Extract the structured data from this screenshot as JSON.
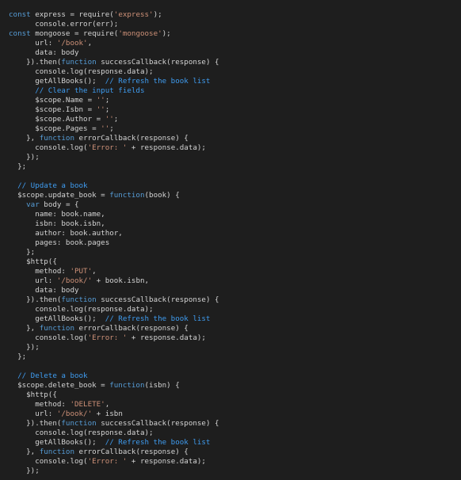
{
  "colors": {
    "background": "#1e1e1e",
    "keyword": "#569cd6",
    "string": "#ce9178",
    "comment": "#3f9cf0",
    "text": "#d4d4d4"
  },
  "lines": [
    [
      [
        "kw",
        "const"
      ],
      [
        "p",
        " express = require("
      ],
      [
        "s",
        "'express'"
      ],
      [
        "p",
        ");"
      ]
    ],
    [
      [
        "p",
        "      console.error(err);"
      ]
    ],
    [
      [
        "kw",
        "const"
      ],
      [
        "p",
        " mongoose = require("
      ],
      [
        "s",
        "'mongoose'"
      ],
      [
        "p",
        ");"
      ]
    ],
    [
      [
        "p",
        "      url: "
      ],
      [
        "s",
        "'/book'"
      ],
      [
        "p",
        ","
      ]
    ],
    [
      [
        "p",
        "      data: body"
      ]
    ],
    [
      [
        "p",
        "    }).then("
      ],
      [
        "kw",
        "function"
      ],
      [
        "p",
        " successCallback(response) {"
      ]
    ],
    [
      [
        "p",
        "      console.log(response.data);"
      ]
    ],
    [
      [
        "p",
        "      getAllBooks();  "
      ],
      [
        "c",
        "// Refresh the book list"
      ]
    ],
    [
      [
        "p",
        "      "
      ],
      [
        "c",
        "// Clear the input fields"
      ]
    ],
    [
      [
        "p",
        "      $scope.Name = "
      ],
      [
        "s",
        "''"
      ],
      [
        "p",
        ";"
      ]
    ],
    [
      [
        "p",
        "      $scope.Isbn = "
      ],
      [
        "s",
        "''"
      ],
      [
        "p",
        ";"
      ]
    ],
    [
      [
        "p",
        "      $scope.Author = "
      ],
      [
        "s",
        "''"
      ],
      [
        "p",
        ";"
      ]
    ],
    [
      [
        "p",
        "      $scope.Pages = "
      ],
      [
        "s",
        "''"
      ],
      [
        "p",
        ";"
      ]
    ],
    [
      [
        "p",
        "    }, "
      ],
      [
        "kw",
        "function"
      ],
      [
        "p",
        " errorCallback(response) {"
      ]
    ],
    [
      [
        "p",
        "      console.log("
      ],
      [
        "s",
        "'Error: '"
      ],
      [
        "p",
        " + response.data);"
      ]
    ],
    [
      [
        "p",
        "    });"
      ]
    ],
    [
      [
        "p",
        "  };"
      ]
    ],
    [
      [
        "p",
        ""
      ]
    ],
    [
      [
        "p",
        "  "
      ],
      [
        "c",
        "// Update a book"
      ]
    ],
    [
      [
        "p",
        "  $scope.update_book = "
      ],
      [
        "kw",
        "function"
      ],
      [
        "p",
        "(book) {"
      ]
    ],
    [
      [
        "p",
        "    "
      ],
      [
        "kw",
        "var"
      ],
      [
        "p",
        " body = {"
      ]
    ],
    [
      [
        "p",
        "      name: book.name,"
      ]
    ],
    [
      [
        "p",
        "      isbn: book.isbn,"
      ]
    ],
    [
      [
        "p",
        "      author: book.author,"
      ]
    ],
    [
      [
        "p",
        "      pages: book.pages"
      ]
    ],
    [
      [
        "p",
        "    };"
      ]
    ],
    [
      [
        "p",
        "    $http({"
      ]
    ],
    [
      [
        "p",
        "      method: "
      ],
      [
        "s",
        "'PUT'"
      ],
      [
        "p",
        ","
      ]
    ],
    [
      [
        "p",
        "      url: "
      ],
      [
        "s",
        "'/book/'"
      ],
      [
        "p",
        " + book.isbn,"
      ]
    ],
    [
      [
        "p",
        "      data: body"
      ]
    ],
    [
      [
        "p",
        "    }).then("
      ],
      [
        "kw",
        "function"
      ],
      [
        "p",
        " successCallback(response) {"
      ]
    ],
    [
      [
        "p",
        "      console.log(response.data);"
      ]
    ],
    [
      [
        "p",
        "      getAllBooks();  "
      ],
      [
        "c",
        "// Refresh the book list"
      ]
    ],
    [
      [
        "p",
        "    }, "
      ],
      [
        "kw",
        "function"
      ],
      [
        "p",
        " errorCallback(response) {"
      ]
    ],
    [
      [
        "p",
        "      console.log("
      ],
      [
        "s",
        "'Error: '"
      ],
      [
        "p",
        " + response.data);"
      ]
    ],
    [
      [
        "p",
        "    });"
      ]
    ],
    [
      [
        "p",
        "  };"
      ]
    ],
    [
      [
        "p",
        ""
      ]
    ],
    [
      [
        "p",
        "  "
      ],
      [
        "c",
        "// Delete a book"
      ]
    ],
    [
      [
        "p",
        "  $scope.delete_book = "
      ],
      [
        "kw",
        "function"
      ],
      [
        "p",
        "(isbn) {"
      ]
    ],
    [
      [
        "p",
        "    $http({"
      ]
    ],
    [
      [
        "p",
        "      method: "
      ],
      [
        "s",
        "'DELETE'"
      ],
      [
        "p",
        ","
      ]
    ],
    [
      [
        "p",
        "      url: "
      ],
      [
        "s",
        "'/book/'"
      ],
      [
        "p",
        " + isbn"
      ]
    ],
    [
      [
        "p",
        "    }).then("
      ],
      [
        "kw",
        "function"
      ],
      [
        "p",
        " successCallback(response) {"
      ]
    ],
    [
      [
        "p",
        "      console.log(response.data);"
      ]
    ],
    [
      [
        "p",
        "      getAllBooks();  "
      ],
      [
        "c",
        "// Refresh the book list"
      ]
    ],
    [
      [
        "p",
        "    }, "
      ],
      [
        "kw",
        "function"
      ],
      [
        "p",
        " errorCallback(response) {"
      ]
    ],
    [
      [
        "p",
        "      console.log("
      ],
      [
        "s",
        "'Error: '"
      ],
      [
        "p",
        " + response.data);"
      ]
    ],
    [
      [
        "p",
        "    });"
      ]
    ]
  ]
}
